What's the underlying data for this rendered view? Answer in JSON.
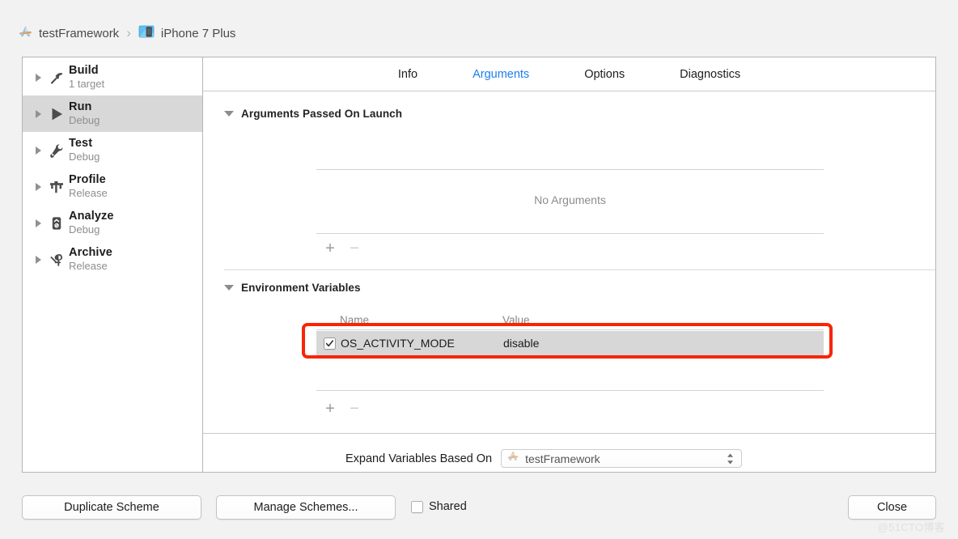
{
  "breadcrumb": {
    "project": "testFramework",
    "separator": "›",
    "destination": "iPhone 7 Plus",
    "project_icon": "xcode-icon",
    "destination_icon": "simulator-icon"
  },
  "sidebar": {
    "items": [
      {
        "title": "Build",
        "subtitle": "1 target",
        "icon": "hammer-icon",
        "selected": false
      },
      {
        "title": "Run",
        "subtitle": "Debug",
        "icon": "play-icon",
        "selected": true
      },
      {
        "title": "Test",
        "subtitle": "Debug",
        "icon": "wrench-icon",
        "selected": false
      },
      {
        "title": "Profile",
        "subtitle": "Release",
        "icon": "caliper-icon",
        "selected": false
      },
      {
        "title": "Analyze",
        "subtitle": "Debug",
        "icon": "analyze-icon",
        "selected": false
      },
      {
        "title": "Archive",
        "subtitle": "Release",
        "icon": "archive-icon",
        "selected": false
      }
    ]
  },
  "tabs": [
    {
      "label": "Info",
      "active": false
    },
    {
      "label": "Arguments",
      "active": true
    },
    {
      "label": "Options",
      "active": false
    },
    {
      "label": "Diagnostics",
      "active": false
    }
  ],
  "arguments_section": {
    "title": "Arguments Passed On Launch",
    "empty_text": "No Arguments",
    "add_label": "+",
    "remove_label": "−"
  },
  "env_section": {
    "title": "Environment Variables",
    "col_name": "Name",
    "col_value": "Value",
    "rows": [
      {
        "enabled": true,
        "name": "OS_ACTIVITY_MODE",
        "value": "disable",
        "highlighted": true
      }
    ],
    "add_label": "+",
    "remove_label": "−"
  },
  "expand": {
    "label": "Expand Variables Based On",
    "value": "testFramework",
    "icon": "xcode-icon"
  },
  "footer": {
    "duplicate_scheme": "Duplicate Scheme",
    "manage_schemes": "Manage Schemes...",
    "shared_label": "Shared",
    "shared_checked": false,
    "close": "Close"
  },
  "watermark": "@51CTO博客",
  "colors": {
    "accent_blue": "#1a7fec",
    "highlight_red": "#f72505",
    "selected_row": "#d7d7d7",
    "window_bg": "#f2f2f2"
  }
}
